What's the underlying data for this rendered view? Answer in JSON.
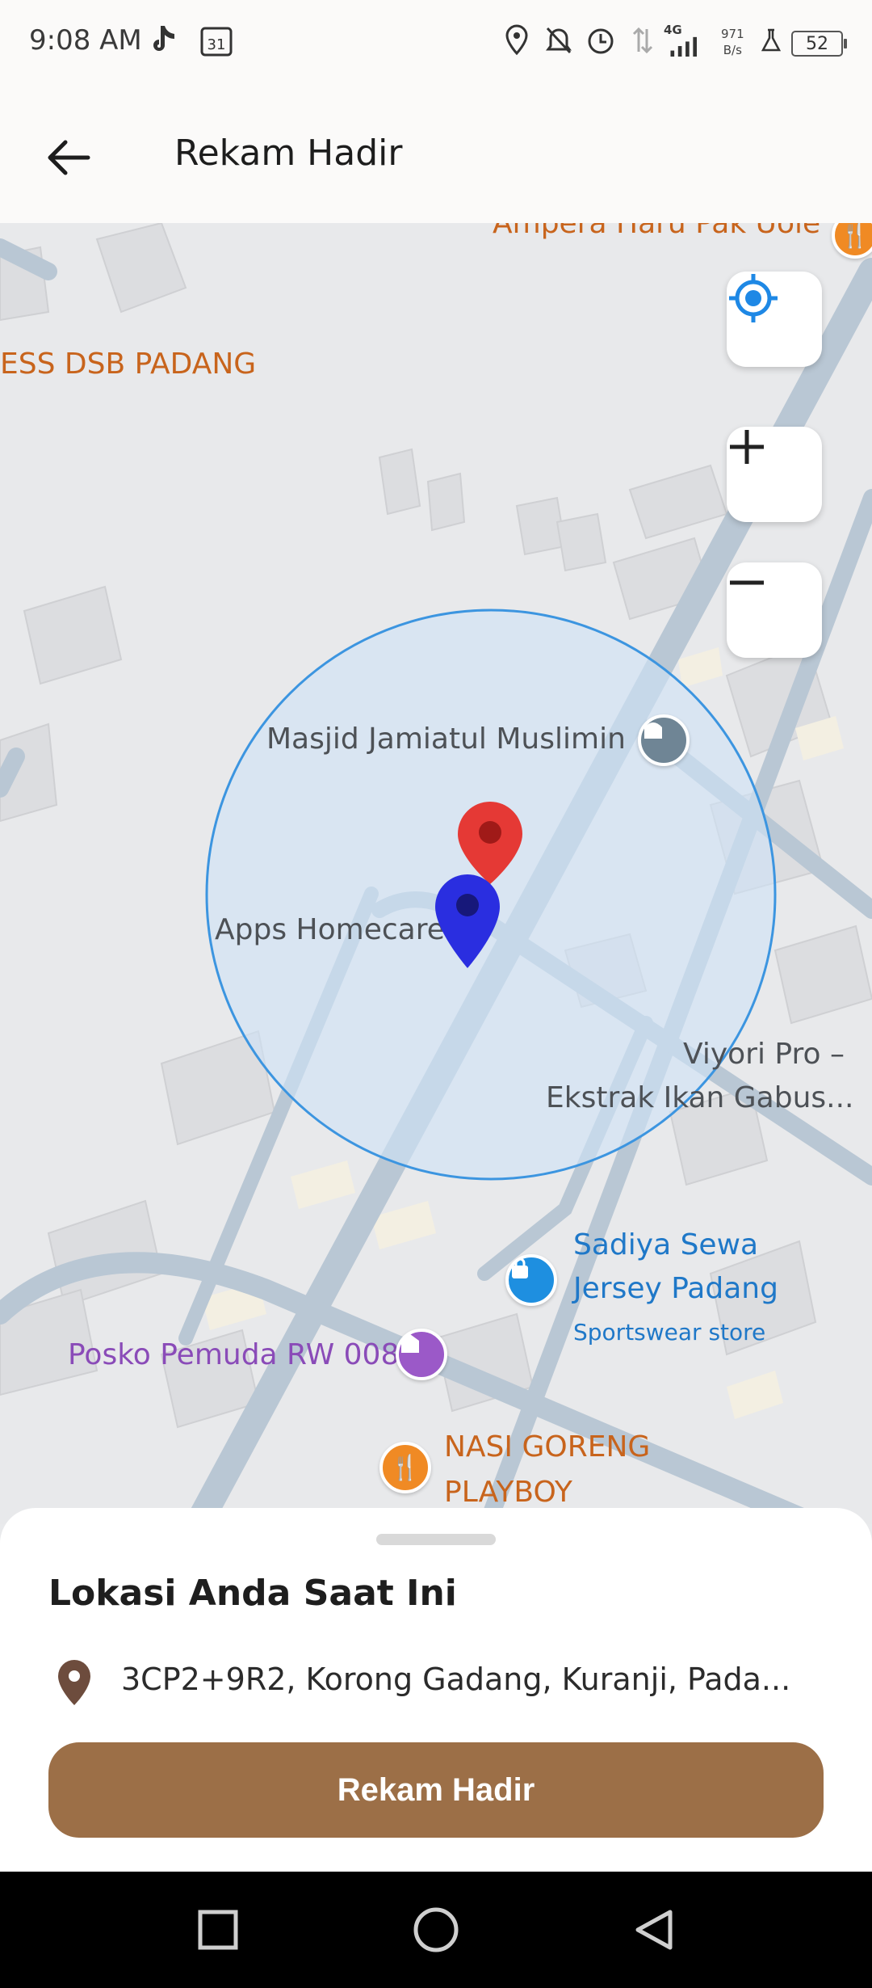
{
  "status_bar": {
    "time": "9:08 AM",
    "calendar_day": "31",
    "network": "4G",
    "speed_value": "971",
    "speed_unit": "B/s",
    "battery": "52",
    "icons": [
      "tiktok-icon",
      "calendar-icon",
      "location-icon",
      "mute-icon",
      "alarm-icon",
      "data-arrows-icon",
      "signal-icon",
      "lab-icon",
      "battery-icon"
    ]
  },
  "header": {
    "title": "Rekam Hadir",
    "back_icon": "arrow-left-icon"
  },
  "map": {
    "labels": {
      "top_truncated": "Ampera Haru Pak Uole",
      "left_truncated": "ESS DSB PADANG",
      "mosque": "Masjid Jamiatul Muslimin",
      "apps_homecare": "Apps Homecare",
      "viyori_line1": "Viyori Pro –",
      "viyori_line2": "Ekstrak Ikan Gabus...",
      "sadiya_line1": "Sadiya Sewa",
      "sadiya_line2": "Jersey Padang",
      "sadiya_type": "Sportswear store",
      "posko": "Posko Pemuda RW 008",
      "nasi_line1": "NASI GORENG",
      "nasi_line2": "PLAYBOY"
    },
    "controls": {
      "locate_icon": "my-location-icon",
      "zoom_in_icon": "plus-icon",
      "zoom_out_icon": "minus-icon"
    },
    "colors": {
      "red_marker": "#e53935",
      "blue_marker": "#2a2ee0",
      "radius_fill": "#cfe3f7",
      "radius_stroke": "#3c95e0"
    }
  },
  "sheet": {
    "title": "Lokasi Anda Saat Ini",
    "address": "3CP2+9R2, Korong Gadang, Kuranji, Pada...",
    "button_label": "Rekam Hadir",
    "button_color": "#9c6f47"
  },
  "nav_bar": {
    "icons": [
      "recents-square-icon",
      "home-circle-icon",
      "back-triangle-icon"
    ]
  }
}
